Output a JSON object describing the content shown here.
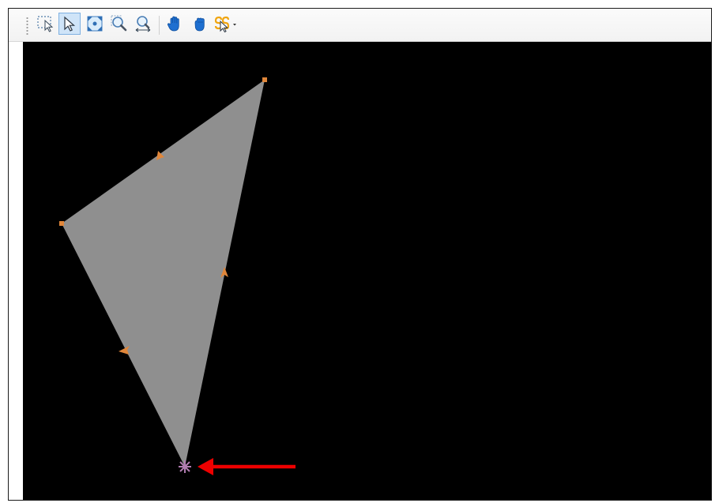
{
  "toolbar": {
    "tools": [
      {
        "icon": "rectangle-select-icon",
        "active": false
      },
      {
        "icon": "pointer-select-icon",
        "active": true
      },
      {
        "icon": "zoom-to-extent-icon",
        "active": false
      },
      {
        "icon": "zoom-in-icon",
        "active": false
      },
      {
        "icon": "zoom-out-icon",
        "active": false
      },
      {
        "icon": "pan-hand-icon",
        "active": false
      },
      {
        "icon": "pan-grab-icon",
        "active": false
      },
      {
        "icon": "snapping-dropdown-icon",
        "active": false
      }
    ]
  },
  "canvas": {
    "background": "#000000",
    "polygon_fill": "#8f8f8f",
    "vertex_color": "#e0863a",
    "selected_vertex_color": "#b07cb0"
  },
  "annotation": {
    "arrow_color": "#ee0000"
  }
}
